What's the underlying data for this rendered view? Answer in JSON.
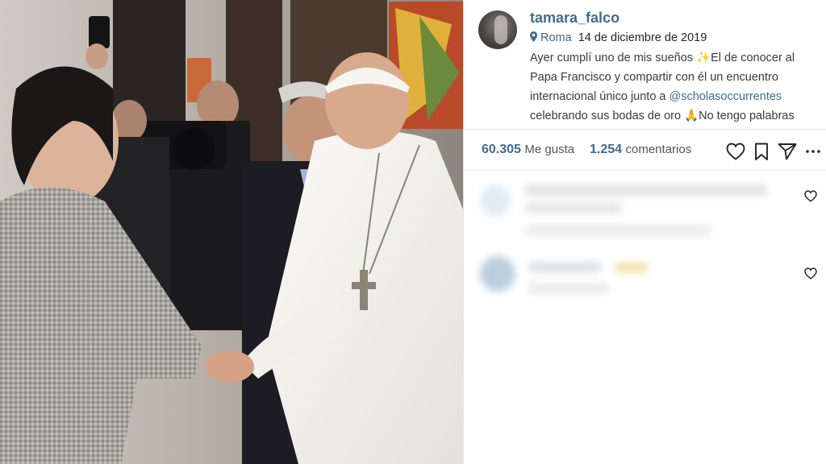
{
  "post": {
    "username": "tamara_falco",
    "location": "Roma",
    "date": "14 de diciembre de 2019",
    "caption": {
      "part1": "Ayer cumplí uno de mis sueños ✨El de conocer al Papa Francisco y compartir con él un encuentro internacional único junto a ",
      "mention": "@scholasoccurrentes",
      "part2": " celebrando sus bodas de oro 🙏No tengo palabras para agradecer a quién me"
    }
  },
  "stats": {
    "likes_count": "60.305",
    "likes_label": "Me gusta",
    "comments_count": "1.254",
    "comments_label": "comentarios"
  },
  "icons": {
    "like": "heart-icon",
    "save": "bookmark-icon",
    "share": "send-icon",
    "more": "more-options-icon",
    "location": "location-pin-icon"
  },
  "colors": {
    "link": "#3f6c8f",
    "text": "#262626"
  }
}
